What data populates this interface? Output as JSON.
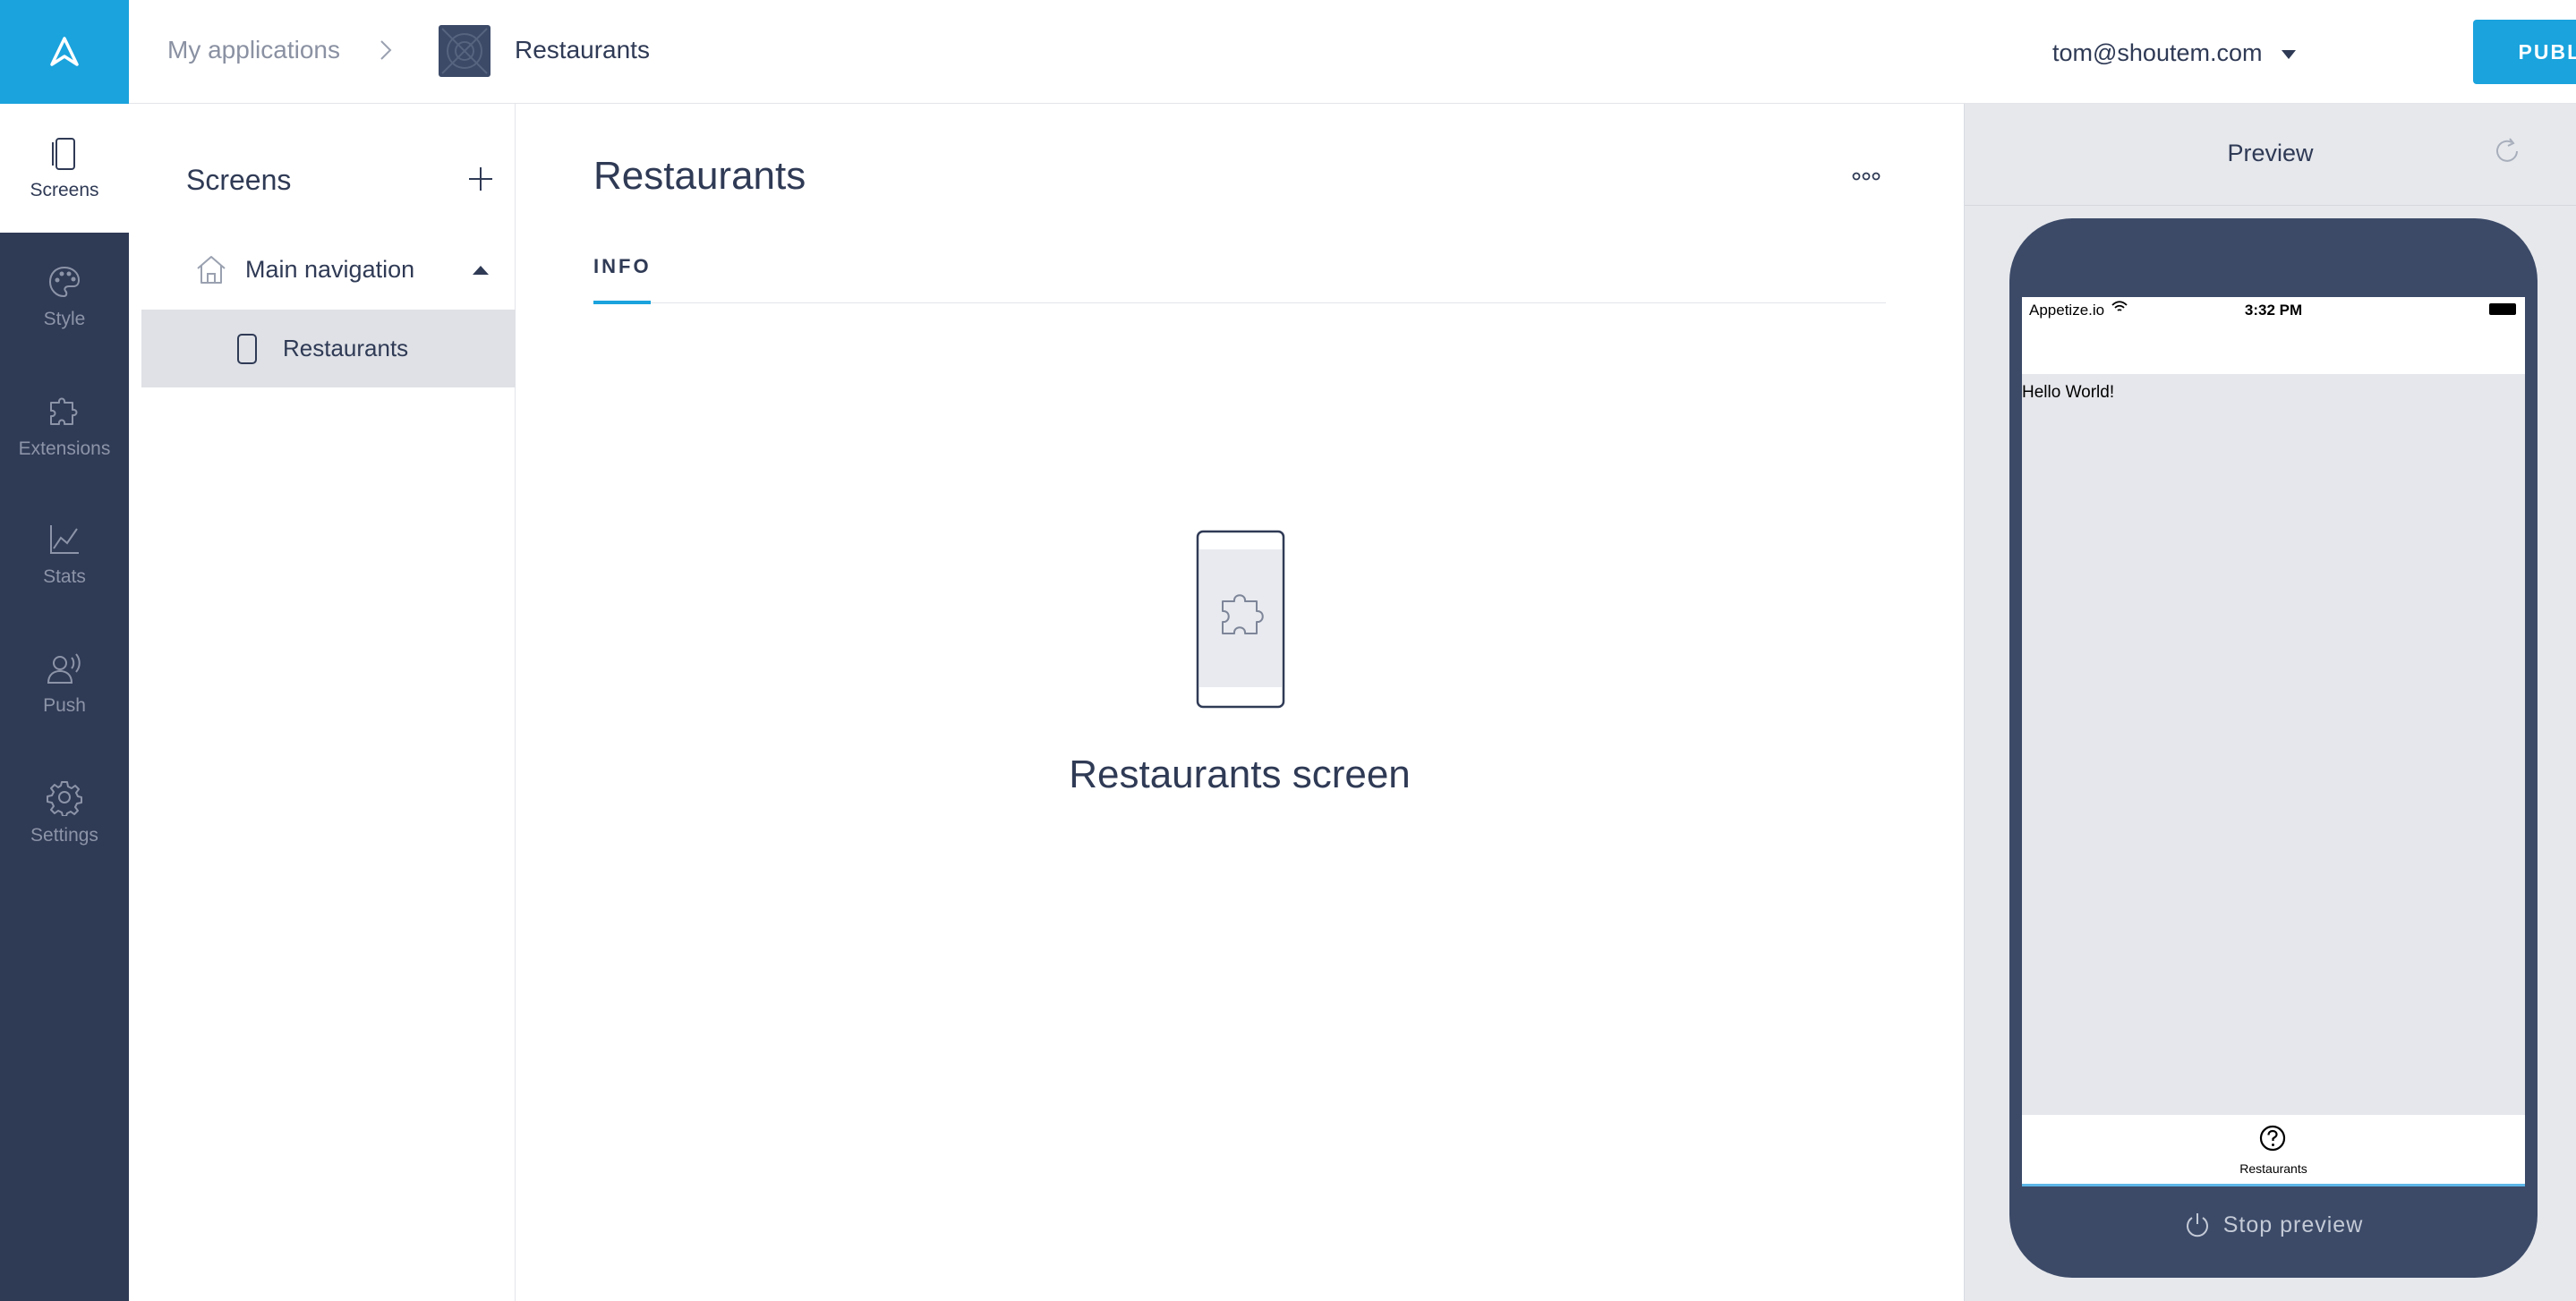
{
  "header": {
    "breadcrumb_root": "My applications",
    "app_name": "Restaurants",
    "user_email": "tom@shoutem.com",
    "publish_label": "PUBLISH"
  },
  "leftnav": {
    "items": [
      {
        "label": "Screens",
        "icon": "screens-icon",
        "active": true
      },
      {
        "label": "Style",
        "icon": "palette-icon",
        "active": false
      },
      {
        "label": "Extensions",
        "icon": "puzzle-icon",
        "active": false
      },
      {
        "label": "Stats",
        "icon": "chart-icon",
        "active": false
      },
      {
        "label": "Push",
        "icon": "push-icon",
        "active": false
      },
      {
        "label": "Settings",
        "icon": "gear-icon",
        "active": false
      }
    ]
  },
  "screens_panel": {
    "title": "Screens",
    "main_navigation_label": "Main navigation",
    "screens": [
      {
        "label": "Restaurants",
        "selected": true
      }
    ]
  },
  "main": {
    "title": "Restaurants",
    "tabs": [
      {
        "label": "INFO",
        "active": true
      }
    ],
    "empty_state_text": "Restaurants screen"
  },
  "preview": {
    "title": "Preview",
    "status_bar": {
      "carrier": "Appetize.io",
      "time": "3:32 PM"
    },
    "content_text": "Hello World!",
    "tab_label": "Restaurants",
    "stop_label": "Stop preview"
  },
  "colors": {
    "accent": "#1aa3dd",
    "sidebar": "#2f3a55",
    "phone_frame": "#3c4a68"
  }
}
